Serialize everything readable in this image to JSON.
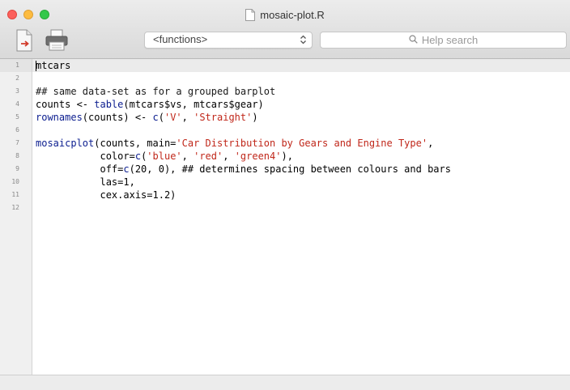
{
  "window": {
    "title": "mosaic-plot.R"
  },
  "toolbar": {
    "functions_label": "<functions>",
    "help_search_placeholder": "Help search"
  },
  "editor": {
    "line_numbers": [
      "1",
      "2",
      "3",
      "4",
      "5",
      "6",
      "7",
      "8",
      "9",
      "10",
      "11",
      "12"
    ],
    "lines": [
      [
        {
          "t": "mtcars",
          "k": "plain"
        }
      ],
      [],
      [
        {
          "t": "## same data-set as for a grouped barplot",
          "k": "comment"
        }
      ],
      [
        {
          "t": "counts <- ",
          "k": "plain"
        },
        {
          "t": "table",
          "k": "fn"
        },
        {
          "t": "(mtcars$vs, mtcars$gear)",
          "k": "plain"
        }
      ],
      [
        {
          "t": "rownames",
          "k": "fn"
        },
        {
          "t": "(counts) <- ",
          "k": "plain"
        },
        {
          "t": "c",
          "k": "fn"
        },
        {
          "t": "(",
          "k": "plain"
        },
        {
          "t": "'V'",
          "k": "str"
        },
        {
          "t": ", ",
          "k": "plain"
        },
        {
          "t": "'Straight'",
          "k": "str"
        },
        {
          "t": ")",
          "k": "plain"
        }
      ],
      [],
      [
        {
          "t": "mosaicplot",
          "k": "fn"
        },
        {
          "t": "(counts, main=",
          "k": "plain"
        },
        {
          "t": "'Car Distribution by Gears and Engine Type'",
          "k": "str"
        },
        {
          "t": ",",
          "k": "plain"
        }
      ],
      [
        {
          "t": "           color=",
          "k": "plain"
        },
        {
          "t": "c",
          "k": "fn"
        },
        {
          "t": "(",
          "k": "plain"
        },
        {
          "t": "'blue'",
          "k": "str"
        },
        {
          "t": ", ",
          "k": "plain"
        },
        {
          "t": "'red'",
          "k": "str"
        },
        {
          "t": ", ",
          "k": "plain"
        },
        {
          "t": "'green4'",
          "k": "str"
        },
        {
          "t": "),",
          "k": "plain"
        }
      ],
      [
        {
          "t": "           off=",
          "k": "plain"
        },
        {
          "t": "c",
          "k": "fn"
        },
        {
          "t": "(20, 0), ## determines spacing between colours and bars",
          "k": "plain"
        }
      ],
      [
        {
          "t": "           las=1,",
          "k": "plain"
        }
      ],
      [
        {
          "t": "           cex.axis=1.2)",
          "k": "plain"
        }
      ],
      []
    ]
  },
  "colors": {
    "function": "#0b1d8f",
    "string": "#c0271a",
    "text": "#000000"
  },
  "icons": {
    "new_document": "new-document-icon",
    "print": "print-icon",
    "search": "magnifier-icon",
    "popup": "up-down-chevron-icon",
    "file": "document-icon"
  }
}
